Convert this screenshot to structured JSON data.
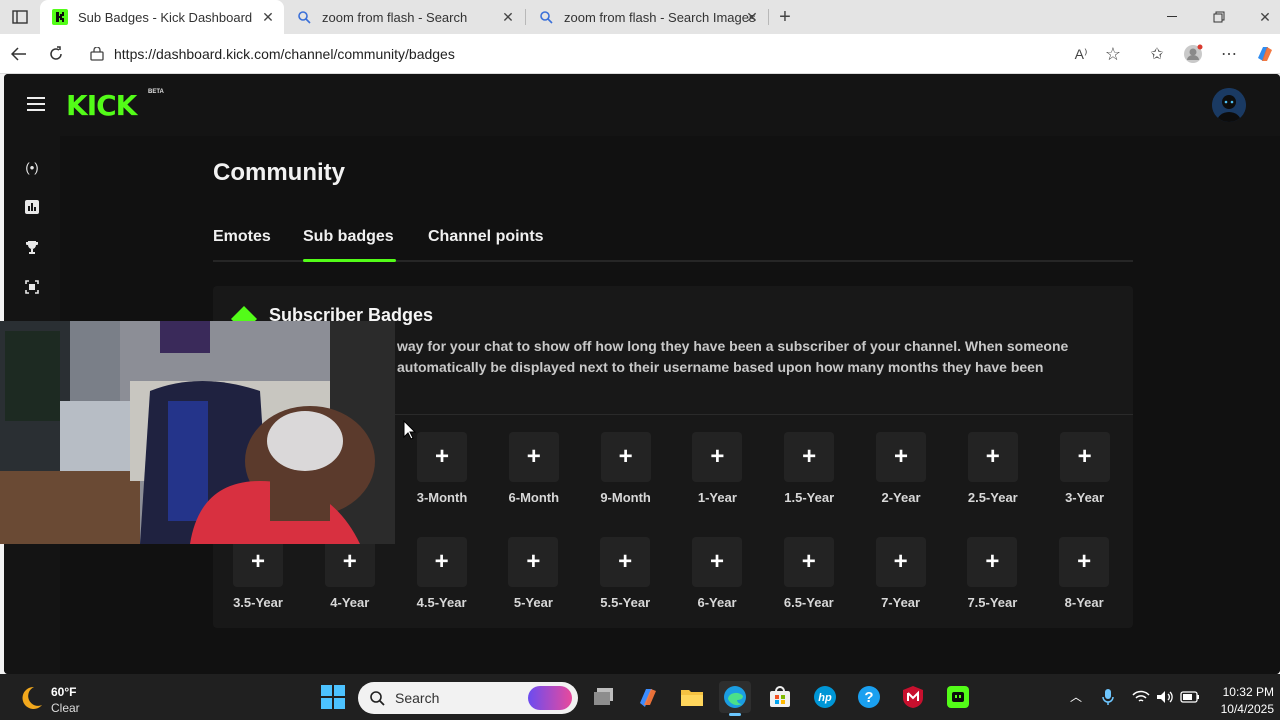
{
  "browser": {
    "tabs": [
      {
        "title": "Sub Badges - Kick Dashboard",
        "active": true,
        "icon": "kick-favicon"
      },
      {
        "title": "zoom from flash - Search",
        "active": false,
        "icon": "search-icon"
      },
      {
        "title": "zoom from flash - Search Images",
        "active": false,
        "icon": "search-icon"
      }
    ],
    "url": "https://dashboard.kick.com/channel/community/badges"
  },
  "app": {
    "logo": "KICK",
    "logo_badge": "BETA",
    "accent_color": "#53fc18"
  },
  "sidebar": {
    "icons": [
      "broadcast-icon",
      "analytics-icon",
      "trophy-icon",
      "screen-capture-icon"
    ]
  },
  "page": {
    "title": "Community",
    "tabs": [
      {
        "label": "Emotes",
        "active": false
      },
      {
        "label": "Sub badges",
        "active": true
      },
      {
        "label": "Channel points",
        "active": false
      }
    ],
    "card": {
      "title": "Subscriber Badges",
      "desc_line1": "way for your chat to show off how long they have been a subscriber of your channel. When someone",
      "desc_line2": "automatically be displayed next to their username based upon how many months they have been"
    },
    "badges_row1": [
      "3-Month",
      "6-Month",
      "9-Month",
      "1-Year",
      "1.5-Year",
      "2-Year",
      "2.5-Year",
      "3-Year"
    ],
    "badges_row2": [
      "3.5-Year",
      "4-Year",
      "4.5-Year",
      "5-Year",
      "5.5-Year",
      "6-Year",
      "6.5-Year",
      "7-Year",
      "7.5-Year",
      "8-Year"
    ],
    "add_glyph": "+"
  },
  "taskbar": {
    "weather_temp": "60°F",
    "weather_cond": "Clear",
    "search_label": "Search",
    "time": "10:32 PM",
    "date": "10/4/2025"
  }
}
